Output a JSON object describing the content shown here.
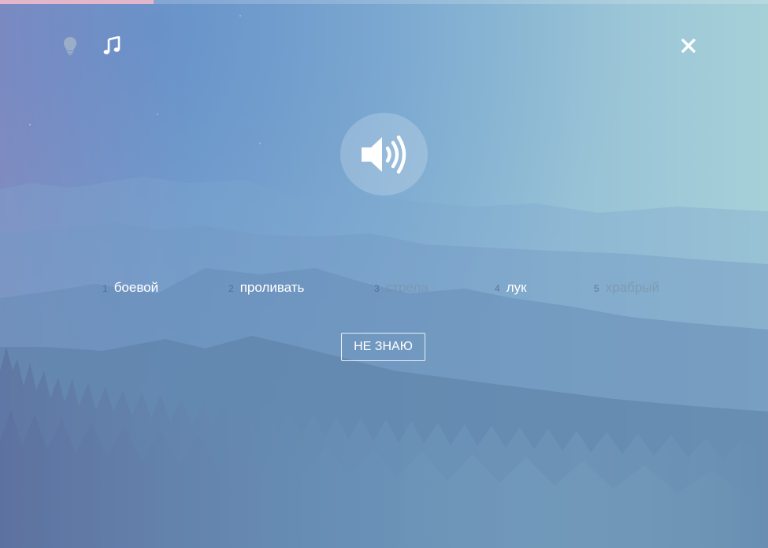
{
  "progress": {
    "fraction": 0.2
  },
  "toolbar": {
    "hint_icon": "lightbulb-icon",
    "music_icon": "music-note-icon",
    "close_icon": "close-icon"
  },
  "audio": {
    "icon": "speaker-volume-icon"
  },
  "options": [
    {
      "number": "1",
      "word": "боевой",
      "state": "normal"
    },
    {
      "number": "2",
      "word": "проливать",
      "state": "normal"
    },
    {
      "number": "3",
      "word": "стрела",
      "state": "dim"
    },
    {
      "number": "4",
      "word": "лук",
      "state": "normal"
    },
    {
      "number": "5",
      "word": "храбрый",
      "state": "dim"
    }
  ],
  "dont_know_label": "НЕ ЗНАЮ",
  "colors": {
    "progress_fill": "#e3b6cc",
    "text_primary": "#ffffff"
  }
}
